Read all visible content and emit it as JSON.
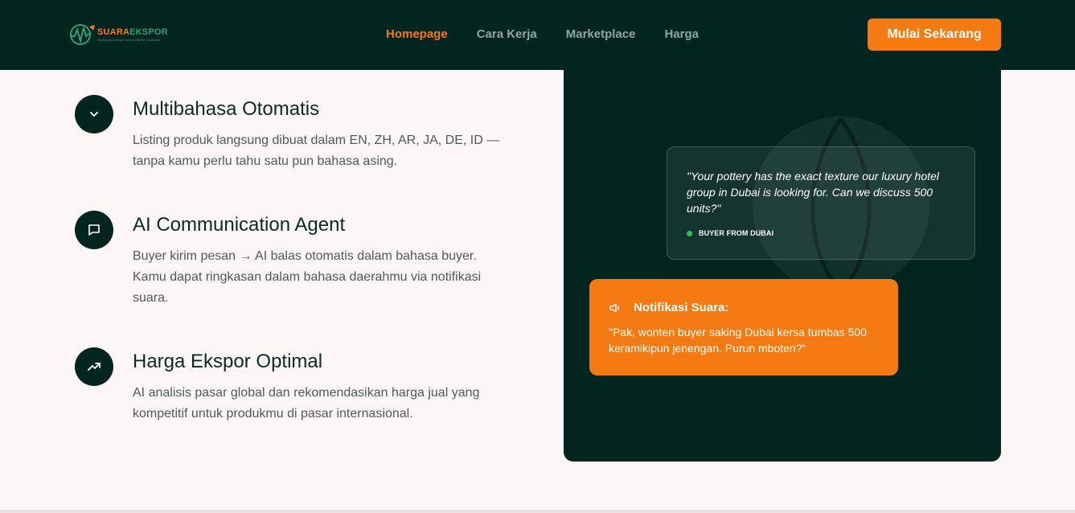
{
  "brand": {
    "name_part1": "SUARA",
    "name_part2": "EKSPOR",
    "tagline": "Marketplace ekspor untuk UMKM Indonesia"
  },
  "nav": {
    "items": [
      {
        "label": "Homepage",
        "active": true
      },
      {
        "label": "Cara Kerja",
        "active": false
      },
      {
        "label": "Marketplace",
        "active": false
      },
      {
        "label": "Harga",
        "active": false
      }
    ],
    "cta_label": "Mulai Sekarang"
  },
  "features": [
    {
      "icon": "chevron-down-icon",
      "title": "Multibahasa Otomatis",
      "description": "Listing produk langsung dibuat dalam EN, ZH, AR, JA, DE, ID — tanpa kamu perlu tahu satu pun bahasa asing."
    },
    {
      "icon": "chat-bubble-icon",
      "title": "AI Communication Agent",
      "description": "Buyer kirim pesan → AI balas otomatis dalam bahasa buyer. Kamu dapat ringkasan dalam bahasa daerahmu via notifikasi suara."
    },
    {
      "icon": "trending-up-icon",
      "title": "Harga Ekspor Optimal",
      "description": "AI analisis pasar global dan rekomendasikan harga jual yang kompetitif untuk produkmu di pasar internasional."
    }
  ],
  "buyer_message": {
    "text": "\"Your pottery has the exact texture our luxury hotel group in Dubai is looking for. Can we discuss 500 units?\"",
    "source": "BUYER FROM DUBAI"
  },
  "voice_notification": {
    "icon": "speaker-icon",
    "title": "Notifikasi Suara:",
    "text": "\"Pak, wonten buyer saking Dubai kersa tumbas 500 keramikipun jenengan. Purun mboten?\""
  },
  "colors": {
    "dark_green": "#032520",
    "orange": "#f57a12",
    "online_green": "#22c55e",
    "background": "#fcf7f6"
  }
}
